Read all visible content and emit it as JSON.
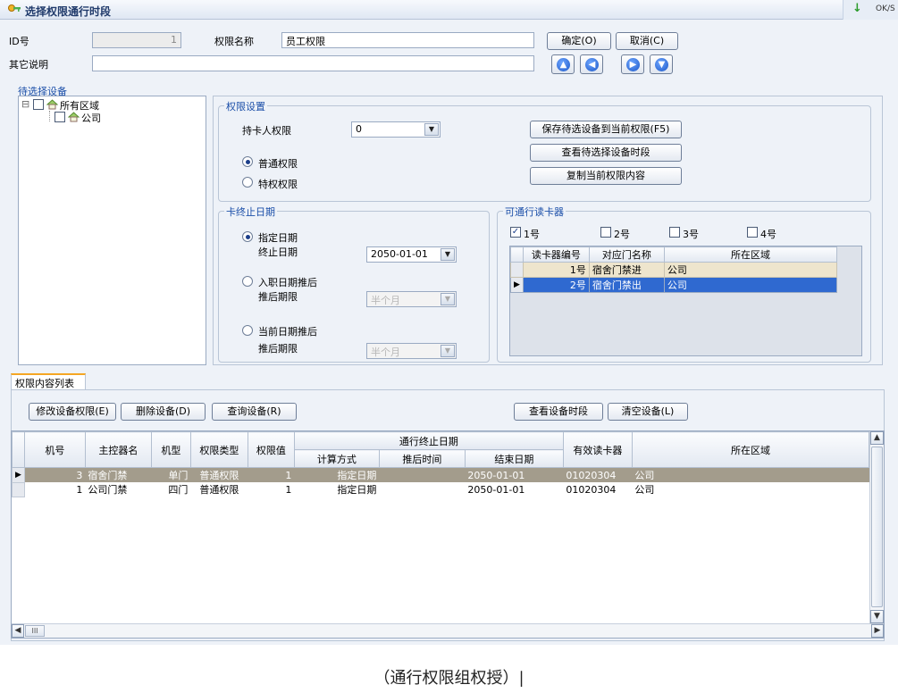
{
  "window": {
    "title": "选择权限通行时段",
    "corner_text": "OK/S",
    "corner_arrow": "↓"
  },
  "header": {
    "id_label": "ID号",
    "id_value": "1",
    "name_label": "权限名称",
    "name_value": "员工权限",
    "desc_label": "其它说明",
    "desc_value": "",
    "ok_button": "确定(O)",
    "cancel_button": "取消(C)",
    "nav": [
      {
        "name": "first-arrow-icon",
        "glyph": "▲"
      },
      {
        "name": "prev-arrow-icon",
        "glyph": "◀"
      },
      {
        "name": "next-arrow-icon",
        "glyph": "▶"
      },
      {
        "name": "last-arrow-icon",
        "glyph": "▼"
      }
    ]
  },
  "tree": {
    "title": "待选择设备",
    "root": "所有区域",
    "child": "公司",
    "expander": "⊟"
  },
  "permission": {
    "group_title": "权限设置",
    "holder_label": "持卡人权限",
    "holder_value": "0",
    "normal_label": "普通权限",
    "special_label": "特权权限",
    "normal_selected": true,
    "buttons": [
      "保存待选设备到当前权限(F5)",
      "查看待选择设备时段",
      "复制当前权限内容"
    ]
  },
  "expiry": {
    "group_title": "卡终止日期",
    "opt1_label": "指定日期",
    "end_label": "终止日期",
    "end_value": "2050-01-01",
    "opt2_label": "入职日期推后",
    "delay_label": "推后期限",
    "delay_value": "半个月",
    "opt3_label": "当前日期推后",
    "delay2_label": "推后期限",
    "delay2_value": "半个月"
  },
  "readers": {
    "group_title": "可通行读卡器",
    "checks": [
      {
        "label": "1号",
        "checked": true
      },
      {
        "label": "2号",
        "checked": false
      },
      {
        "label": "3号",
        "checked": false
      },
      {
        "label": "4号",
        "checked": false
      }
    ],
    "columns": [
      "读卡器编号",
      "对应门名称",
      "所在区域"
    ],
    "rows": [
      {
        "no": "1号",
        "door": "宿舍门禁进",
        "area": "公司"
      },
      {
        "no": "2号",
        "door": "宿舍门禁出",
        "area": "公司"
      }
    ]
  },
  "content": {
    "tab_label": "权限内容列表",
    "buttons_left": [
      "修改设备权限(E)",
      "删除设备(D)",
      "查询设备(R)"
    ],
    "buttons_right": [
      "查看设备时段",
      "清空设备(L)"
    ],
    "columns": {
      "machine": "机号",
      "controller": "主控器名",
      "type": "机型",
      "perm_type": "权限类型",
      "perm_value": "权限值",
      "end_group": "通行终止日期",
      "calc": "计算方式",
      "delay": "推后时间",
      "end_date": "结束日期",
      "valid_readers": "有效读卡器",
      "area": "所在区域"
    },
    "rows": [
      {
        "machine": "3",
        "controller": "宿舍门禁",
        "type": "单门",
        "perm_type": "普通权限",
        "perm_value": "1",
        "calc": "指定日期",
        "delay": "",
        "end_date": "2050-01-01",
        "valid_readers": "01020304",
        "area": "公司"
      },
      {
        "machine": "1",
        "controller": "公司门禁",
        "type": "四门",
        "perm_type": "普通权限",
        "perm_value": "1",
        "calc": "指定日期",
        "delay": "",
        "end_date": "2050-01-01",
        "valid_readers": "01020304",
        "area": "公司"
      }
    ],
    "scroll_label": "III"
  },
  "caption": "（通行权限组权授）|"
}
